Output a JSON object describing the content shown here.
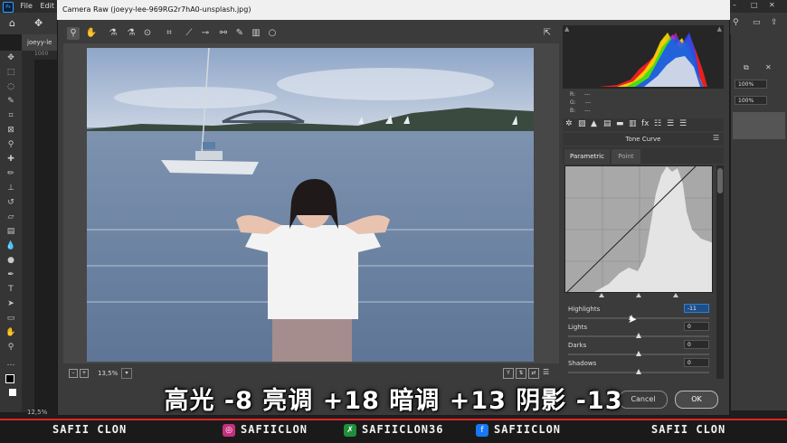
{
  "photoshop": {
    "logo": "Ps",
    "menu": [
      "File",
      "Edit"
    ],
    "doc_tab": "joeyy-le",
    "ruler_mark": "1000",
    "status_zoom": "12,5%",
    "right_panel": {
      "zoom_1": "100%",
      "zoom_2": "100%"
    }
  },
  "camera_raw": {
    "title": "Camera Raw (joeyy-lee-969RG2r7hA0-unsplash.jpg)",
    "rgb": {
      "r_label": "R:",
      "g_label": "G:",
      "b_label": "B:",
      "r": "---",
      "g": "---",
      "b": "---"
    },
    "panel_title": "Tone Curve",
    "tabs": [
      "Parametric",
      "Point"
    ],
    "active_tab": "Parametric",
    "sliders": [
      {
        "label": "Highlights",
        "value": "-11",
        "position": 0.45,
        "active": true
      },
      {
        "label": "Lights",
        "value": "0",
        "position": 0.5
      },
      {
        "label": "Darks",
        "value": "0",
        "position": 0.5
      },
      {
        "label": "Shadows",
        "value": "0",
        "position": 0.5
      }
    ],
    "zoom": "13,5%",
    "cancel_label": "Cancel",
    "ok_label": "OK"
  },
  "subtitle": "高光 -8 亮调 +18 暗调 +13 阴影 -13",
  "banner": {
    "name_left": "SAFII CLON",
    "instagram": "SAFIICLON",
    "other_handle": "SAFIICLON36",
    "facebook": "SAFIICLON",
    "name_right": "SAFII CLON"
  },
  "colors": {
    "accent_red": "#e3232c",
    "dialog_bg": "#3b3b3b",
    "active_field": "#2f7fd1"
  }
}
